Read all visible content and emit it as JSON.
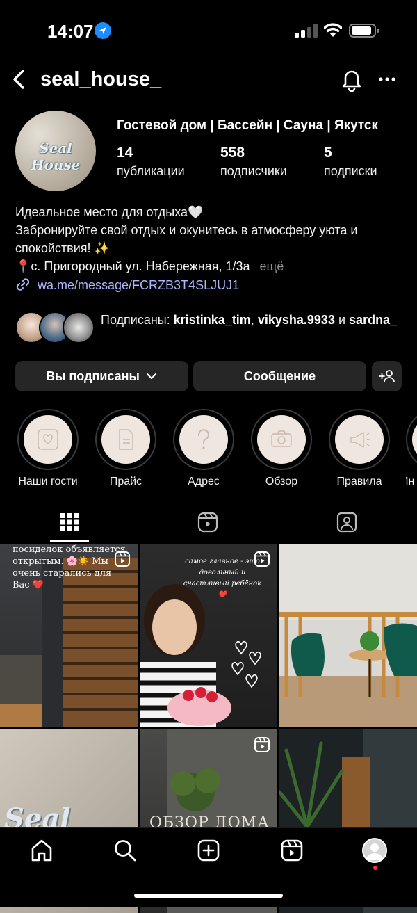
{
  "status_bar": {
    "time": "14:07"
  },
  "header": {
    "username": "seal_house_"
  },
  "profile": {
    "avatar_text": "Seal House",
    "name": "Гостевой дом | Бассейн | Сауна | Якутск",
    "stats": [
      {
        "count": "14",
        "label": "публикации"
      },
      {
        "count": "558",
        "label": "подписчики"
      },
      {
        "count": "5",
        "label": "подписки"
      }
    ],
    "bio": [
      "Идеальное место для отдыха🤍",
      "Забронируйте свой отдых и окунитесь в атмосферу уюта и",
      "спокойствия! ✨",
      "📍с. Пригородный ул. Набережная, 1/3а"
    ],
    "bio_more": "ещё",
    "link": "wa.me/message/FCRZB3T4SLJUJ1",
    "followed_by": {
      "prefix": "Подписаны:",
      "user1": "kristinka_tim",
      "sep": ",",
      "user2": "vikysha.9933",
      "and": "и",
      "user3": "sardna_"
    }
  },
  "buttons": {
    "following": "Вы подписаны",
    "message": "Сообщение"
  },
  "highlights": [
    {
      "label": "Наши гости",
      "icon": "heart-hand-icon"
    },
    {
      "label": "Прайс",
      "icon": "document-icon"
    },
    {
      "label": "Адрес",
      "icon": "question-icon"
    },
    {
      "label": "Обзор",
      "icon": "camera-icon"
    },
    {
      "label": "Правила",
      "icon": "megaphone-icon"
    },
    {
      "label": "Ин",
      "icon": "info-icon"
    }
  ],
  "posts": [
    {
      "caption": "посиделок объявляется открытым. 🌸☀️ Мы очень старались для Вас ❤️"
    },
    {
      "caption": "самое главное - это довольный и счастливый ребёнок ❤️"
    },
    {
      "caption": ""
    },
    {
      "caption": "Seal House"
    },
    {
      "caption": "ОБЗОР ДОМА"
    },
    {
      "caption": ""
    }
  ],
  "colors": {
    "background": "#000000",
    "button": "#262626",
    "link": "#a9b8ff",
    "accent": "#1d8cff",
    "notification": "#ff3040"
  }
}
